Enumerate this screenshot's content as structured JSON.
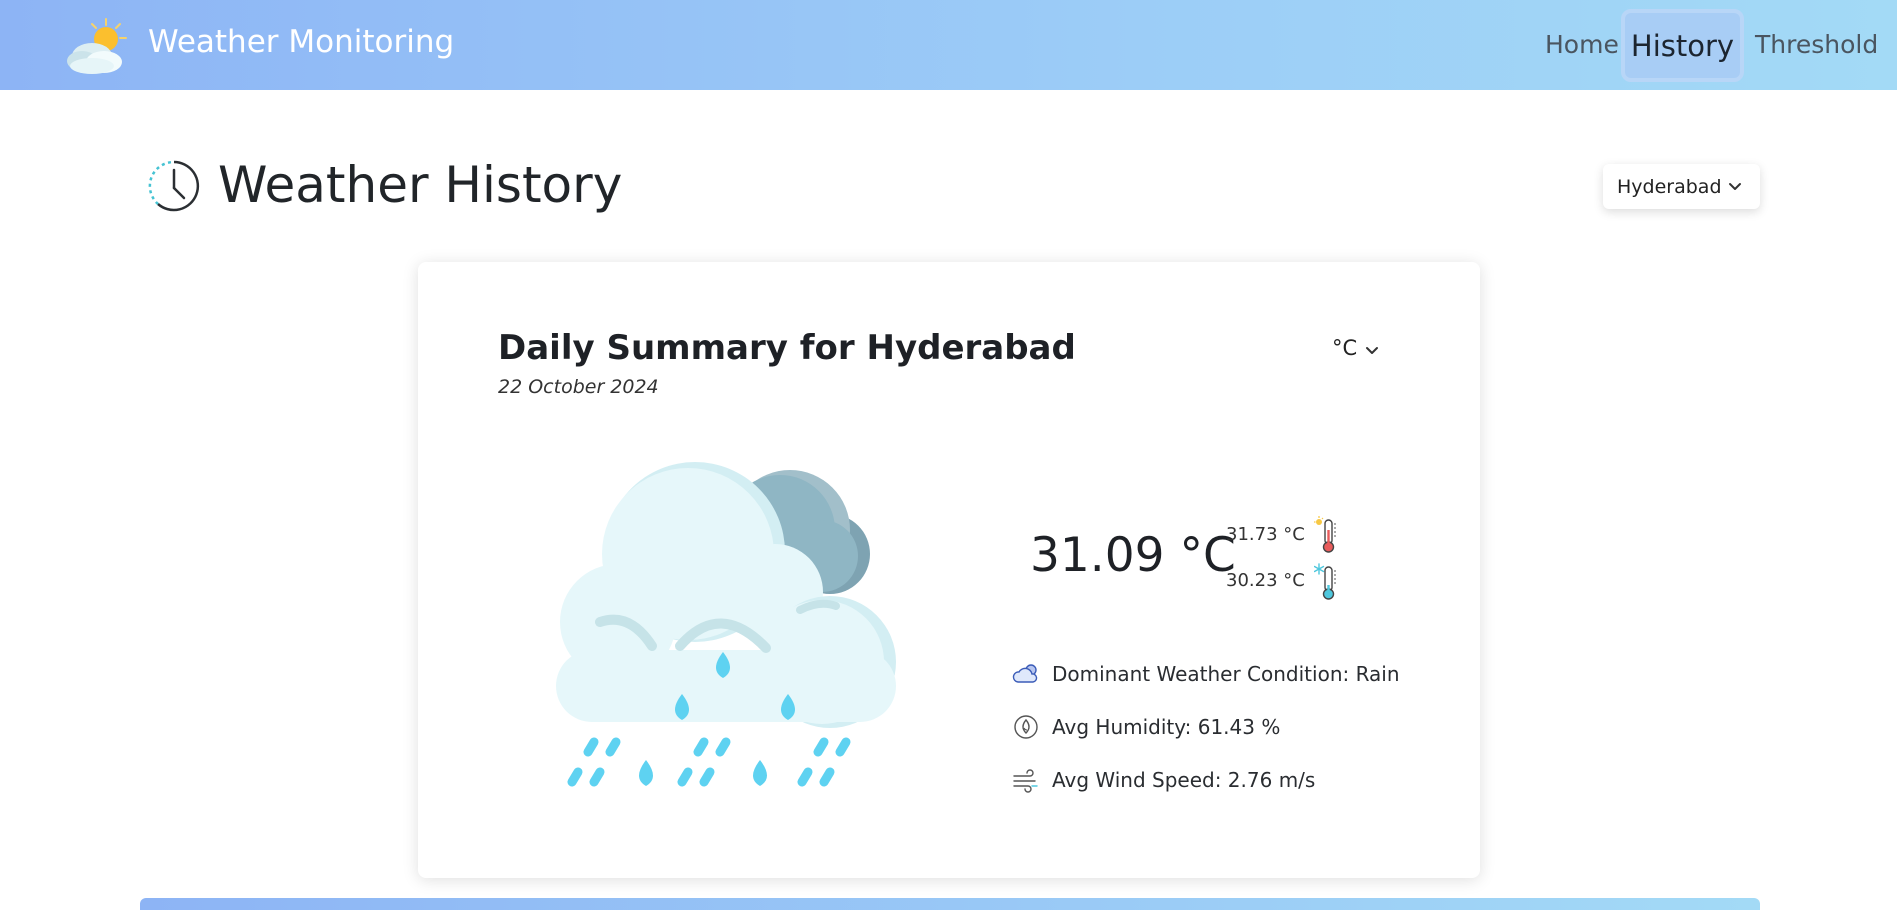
{
  "navbar": {
    "brand": "Weather Monitoring",
    "links": {
      "home": "Home",
      "history": "History",
      "threshold": "Threshold"
    }
  },
  "page": {
    "title": "Weather History",
    "icon": "clock-history-icon"
  },
  "city_select": {
    "selected": "Hyderabad"
  },
  "summary": {
    "title": "Daily Summary for Hyderabad",
    "date": "22 October 2024",
    "unit_selected": "°C",
    "avg_temp": "31.09 °C",
    "max_temp": "31.73 °C",
    "min_temp": "30.23 °C",
    "condition": "Dominant Weather Condition: Rain",
    "humidity": "Avg Humidity: 61.43 %",
    "wind": "Avg Wind Speed: 2.76 m/s"
  },
  "colors": {
    "nav_gradient_start": "#8db4f5",
    "nav_gradient_end": "#a3daf6",
    "cloud_light": "#e6f7fa",
    "cloud_dark": "#8fb6c4",
    "rain": "#5ed2f1"
  }
}
